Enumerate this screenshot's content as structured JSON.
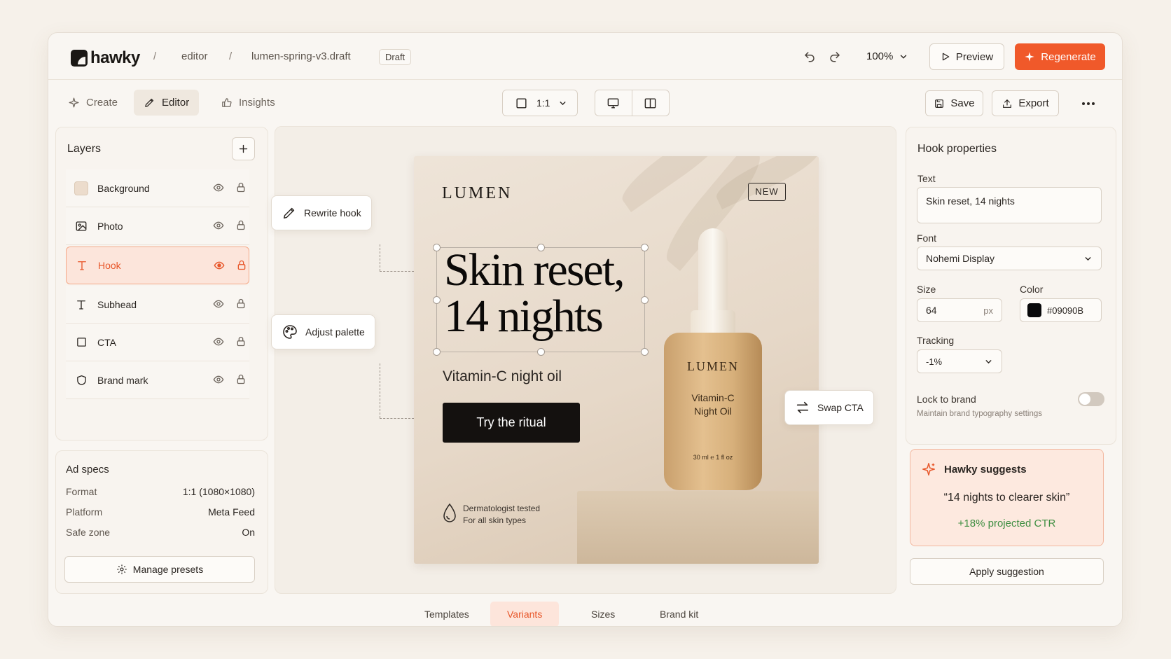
{
  "app": {
    "logo_text": "hawky",
    "breadcrumb": [
      "editor",
      "lumen-spring-v3.draft"
    ],
    "breadcrumb_sep": "/",
    "status_badge": "Draft",
    "zoom_label": "100%",
    "preview_label": "Preview",
    "regenerate_label": "Regenerate",
    "accent_color": "#F0592A"
  },
  "toolbar": {
    "tabs": [
      {
        "label": "Create",
        "icon": "sparkle-icon",
        "active": false
      },
      {
        "label": "Editor",
        "icon": "pencil-icon",
        "active": true
      },
      {
        "label": "Insights",
        "icon": "thumbs-icon",
        "active": false
      }
    ],
    "aspect_label": "1:1",
    "save_label": "Save",
    "export_label": "Export"
  },
  "layers": {
    "title": "Layers",
    "items": [
      {
        "label": "Background",
        "icon": "swatch-icon",
        "selected": false
      },
      {
        "label": "Photo",
        "icon": "image-icon",
        "selected": false
      },
      {
        "label": "Hook",
        "icon": "text-icon",
        "selected": true
      },
      {
        "label": "Subhead",
        "icon": "text-icon",
        "selected": false
      },
      {
        "label": "CTA",
        "icon": "square-icon",
        "selected": false
      },
      {
        "label": "Brand mark",
        "icon": "shield-icon",
        "selected": false
      }
    ]
  },
  "ad_specs": {
    "title": "Ad specs",
    "rows": [
      {
        "label": "Format",
        "value": "1:1 (1080×1080)"
      },
      {
        "label": "Platform",
        "value": "Meta Feed"
      },
      {
        "label": "Safe zone",
        "value": "On"
      }
    ],
    "manage_label": "Manage presets"
  },
  "artboard": {
    "brand": "LUMEN",
    "badge": "NEW",
    "hook": "Skin reset,\n14 nights",
    "subhead": "Vitamin-C night oil",
    "cta": "Try the ritual",
    "trust_line1": "Dermatologist tested",
    "trust_line2": "For all skin types",
    "bottle_brand": "LUMEN",
    "bottle_name": "Vitamin-C\nNight Oil",
    "bottle_volume": "30 ml ℮ 1 fl oz"
  },
  "ai_actions": {
    "rewrite": "Rewrite hook",
    "palette": "Adjust palette",
    "swap": "Swap CTA"
  },
  "properties": {
    "title": "Hook properties",
    "text_label": "Text",
    "text_value": "Skin reset, 14 nights",
    "font_label": "Font",
    "font_value": "Nohemi Display",
    "size_label": "Size",
    "size_value": "64",
    "size_unit": "px",
    "color_label": "Color",
    "color_value": "#09090B",
    "tracking_label": "Tracking",
    "tracking_value": "-1%",
    "lock_label": "Lock to brand",
    "lock_desc": "Maintain brand typography settings",
    "lock_on": false
  },
  "suggestion": {
    "title": "Hawky suggests",
    "quote": "“14 nights to clearer skin”",
    "metric": "+18% projected CTR",
    "apply_label": "Apply suggestion"
  },
  "bottom_tabs": [
    {
      "label": "Templates",
      "active": false
    },
    {
      "label": "Variants",
      "active": true
    },
    {
      "label": "Sizes",
      "active": false
    },
    {
      "label": "Brand kit",
      "active": false
    }
  ]
}
